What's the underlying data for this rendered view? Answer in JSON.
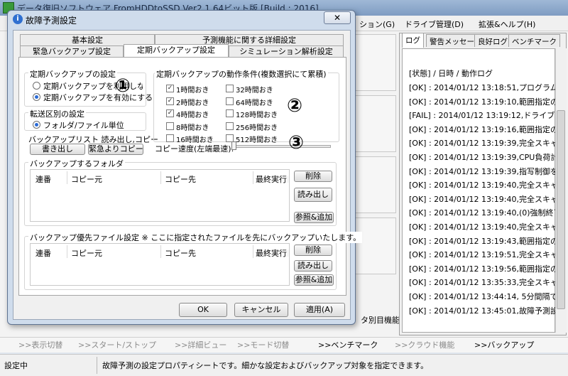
{
  "main_window": {
    "title": "データ復旧ソフトウェア FromHDDtoSSD Ver2.1.64ビット版 [Build : 2016]",
    "menu": [
      "ション(G)",
      "ドライブ管理(D)",
      "拡張&ヘルプ(H)"
    ]
  },
  "log_panel": {
    "tabs": [
      "ログ",
      "警告メッセージ",
      "良好ログ",
      "ベンチマーク"
    ],
    "header": "[状態] / 日時 / 動作ログ",
    "lines": [
      "[OK] : 2014/01/12 13:18:51,プログラム",
      "[OK] : 2014/01/12 13:19:10,範囲指定の",
      "[FAIL] : 2014/01/12 13:19:12,ドライブ",
      "[OK] : 2014/01/12 13:19:16,範囲指定の",
      "[OK] : 2014/01/12 13:19:39,完全スキャ",
      "[OK] : 2014/01/12 13:19:39,CPU負荷計",
      "[OK] : 2014/01/12 13:19:39,指写制御を",
      "[OK] : 2014/01/12 13:19:40,完全スキャ",
      "[OK] : 2014/01/12 13:19:40,完全スキャ",
      "[OK] : 2014/01/12 13:19:40,(0)強制終了",
      "[OK] : 2014/01/12 13:19:40,完全スキャ",
      "[OK] : 2014/01/12 13:19:43,範囲指定の",
      "[OK] : 2014/01/12 13:19:51,完全スキャ",
      "[OK] : 2014/01/12 13:19:56,範囲指定の",
      "[OK] : 2014/01/12 13:35:33,完全スキャ",
      "[OK] : 2014/01/12 13:44:14, 5分間隔で",
      "[OK] : 2014/01/12 13:45:01,故障予測設"
    ]
  },
  "background_label": "タ別目機能",
  "bottom_toolbar": [
    {
      "label": ">>表示切替",
      "active": false
    },
    {
      "label": ">>スタート/ストップ",
      "active": false
    },
    {
      "label": ">>詳細ビュー",
      "active": false
    },
    {
      "label": ">>モード切替",
      "active": false
    },
    {
      "label": ">>ベンチマーク",
      "active": true
    },
    {
      "label": ">>クラウド機能",
      "active": false
    },
    {
      "label": ">>バックアップ",
      "active": true
    }
  ],
  "status_bar": {
    "state": "設定中",
    "message": "故障予測の設定プロパティシートです。細かな設定およびバックアップ対象を指定できます。"
  },
  "dialog": {
    "title": "故障予測設定",
    "close_glyph": "✕",
    "tabs_row1": [
      "基本設定",
      "予測機能に関する詳細設定"
    ],
    "tabs_row2": [
      "緊急バックアップ設定",
      "定期バックアップ設定",
      "シミュレーション解析設定"
    ],
    "periodic": {
      "group_label": "定期バックアップの設定",
      "option_off": "定期バックアップを利用しない",
      "option_on": "定期バックアップを有効にする"
    },
    "transfer": {
      "group_label": "転送区別の設定",
      "option": "フォルダ/ファイル単位"
    },
    "backup_list": {
      "label": "バックアップリスト  読み出し,コピー",
      "export_button": "書き出し",
      "emergency_copy_button": "緊急よりコピー"
    },
    "conditions": {
      "group_label": "定期バックアップの動作条件(複数選択にて累積)",
      "items": [
        {
          "label": "1時間おき",
          "checked": true
        },
        {
          "label": "2時間おき",
          "checked": true
        },
        {
          "label": "4時間おき",
          "checked": true
        },
        {
          "label": "8時間おき",
          "checked": false
        },
        {
          "label": "16時間おき",
          "checked": false
        },
        {
          "label": "32時間おき",
          "checked": false
        },
        {
          "label": "64時間おき",
          "checked": false
        },
        {
          "label": "128時間おき",
          "checked": false
        },
        {
          "label": "256時間おき",
          "checked": false
        },
        {
          "label": "512時間おき",
          "checked": false
        }
      ],
      "speed_label": "コピー速度(左端最速):",
      "check_glyph": "✓"
    },
    "folders": {
      "group_label": "バックアップするフォルダ",
      "columns": [
        "連番",
        "コピー元",
        "コピー先",
        "最終実行日"
      ],
      "delete_button": "削除",
      "load_button": "読み出し",
      "add_button": "参照&追加"
    },
    "priority_files": {
      "group_label": "バックアップ優先ファイル設定 ※ ここに指定されたファイルを先にバックアップいたします。",
      "columns": [
        "連番",
        "コピー元",
        "コピー先",
        "最終実行日"
      ],
      "delete_button": "削除",
      "load_button": "読み出し",
      "add_button": "参照&追加"
    },
    "buttons": {
      "ok": "OK",
      "cancel": "キャンセル",
      "apply": "適用(A)"
    },
    "annotations": [
      "①",
      "②",
      "③"
    ]
  }
}
